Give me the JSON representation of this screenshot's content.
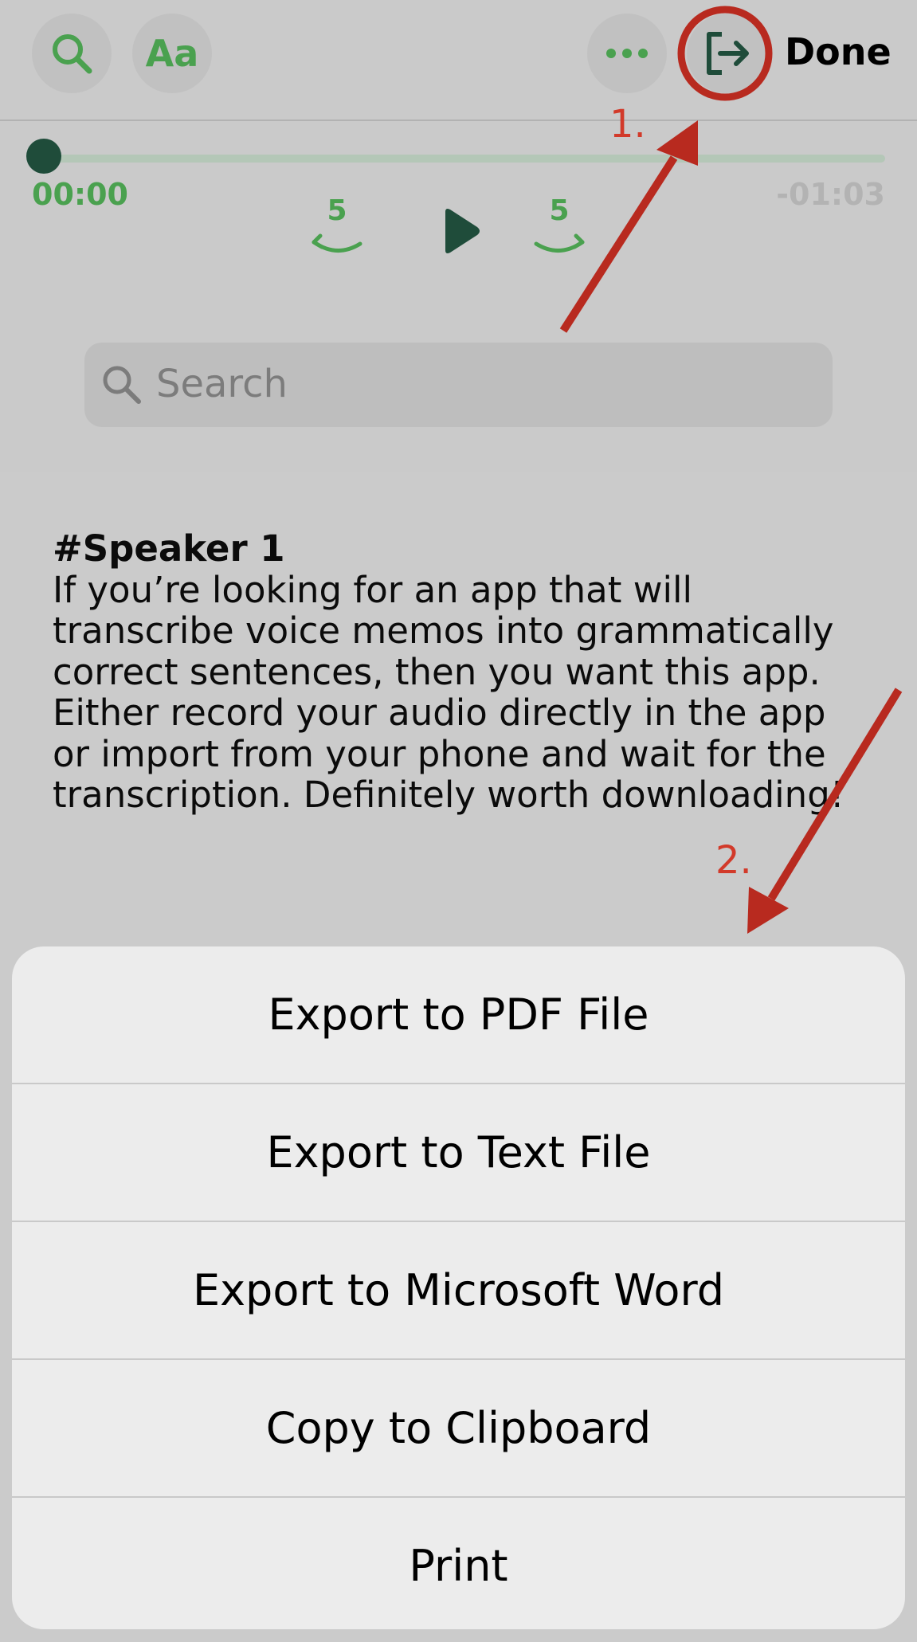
{
  "header": {
    "search_icon": "search-icon",
    "font_button_label": "Aa",
    "more_icon": "more-dots-icon",
    "export_icon": "export-arrow-icon",
    "done_label": "Done"
  },
  "player": {
    "progress": 0,
    "elapsed": "00:00",
    "remaining": "-01:03",
    "skip_back_seconds": "5",
    "skip_forward_seconds": "5",
    "play_icon": "play-icon"
  },
  "search": {
    "placeholder": "Search"
  },
  "transcript": {
    "speaker": "#Speaker 1",
    "text": "If you’re looking for an app that will transcribe voice memos into grammatically correct sentences, then you want this app. Either record your audio directly in the app or import from your phone and wait for the transcription. Definitely worth downloading!"
  },
  "action_sheet": {
    "items": [
      {
        "label": "Export to PDF File"
      },
      {
        "label": "Export to Text File"
      },
      {
        "label": "Export to Microsoft Word"
      },
      {
        "label": "Copy to Clipboard"
      },
      {
        "label": "Print"
      }
    ]
  },
  "annotations": {
    "step1": "1.",
    "step2": "2."
  },
  "colors": {
    "accent_green": "#4aa14f",
    "dark_green": "#1f4c3a",
    "annotation_red": "#b82a1f"
  }
}
